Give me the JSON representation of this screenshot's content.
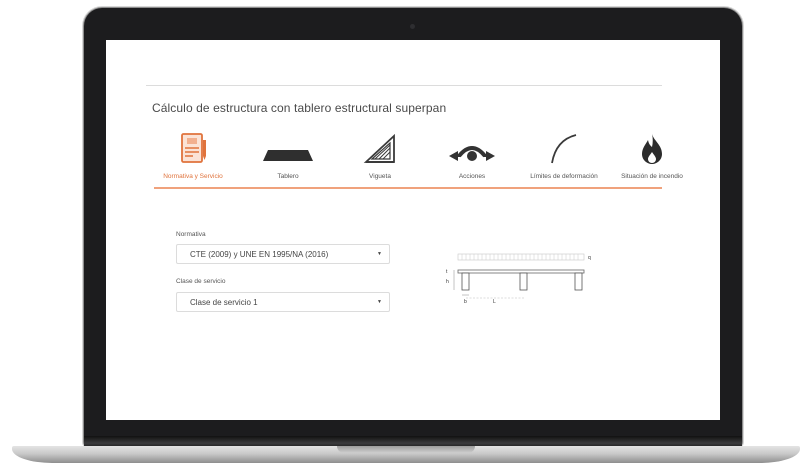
{
  "app": {
    "title": "Cálculo de estructura con tablero estructural superpan"
  },
  "tabs": [
    {
      "label": "Normativa y Servicio",
      "icon": "document-certificate-icon",
      "active": true
    },
    {
      "label": "Tablero",
      "icon": "board-icon",
      "active": false
    },
    {
      "label": "Vigueta",
      "icon": "truss-icon",
      "active": false
    },
    {
      "label": "Acciones",
      "icon": "load-arrows-icon",
      "active": false
    },
    {
      "label": "Límites de deformación",
      "icon": "deflection-curve-icon",
      "active": false
    },
    {
      "label": "Situación de incendio",
      "icon": "fire-icon",
      "active": false
    }
  ],
  "form": {
    "normativa": {
      "label": "Normativa",
      "value": "CTE (2009) y UNE EN 1995/NA (2016)"
    },
    "clase_servicio": {
      "label": "Clase de servicio",
      "value": "Clase de servicio 1"
    }
  },
  "diagram": {
    "labels": {
      "q": "q",
      "t": "t",
      "h": "h",
      "b": "b",
      "L": "L"
    }
  },
  "colors": {
    "accent": "#e0733c",
    "accent_light": "#f0a27c",
    "icon_dark": "#3a3a3a",
    "frame": "#1c1c1e"
  }
}
